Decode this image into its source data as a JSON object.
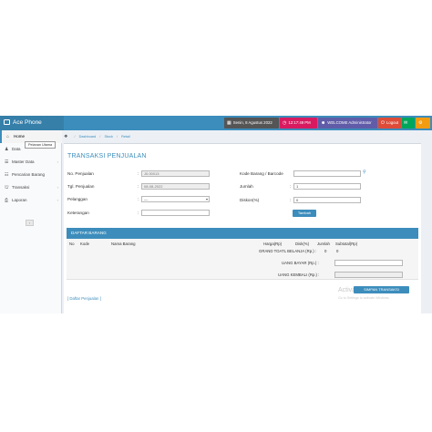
{
  "app": {
    "brand": "Ace Phone"
  },
  "topbar": {
    "date": "Senin, 8 Agustus 2022",
    "time": "12:17:49 PM",
    "user": "WELCOME Administrator",
    "logout": "Logout"
  },
  "sidebar": {
    "items": [
      {
        "label": "Home",
        "icon": "home-icon"
      },
      {
        "label": "Data",
        "icon": "user-icon"
      },
      {
        "label": "Master Data",
        "icon": "list-icon"
      },
      {
        "label": "Pencarian Barang",
        "icon": "search-list-icon"
      },
      {
        "label": "Transaksi",
        "icon": "cart-icon"
      },
      {
        "label": "Laporan",
        "icon": "print-icon"
      }
    ],
    "tooltip": "Pelanan Utama"
  },
  "breadcrumb": {
    "items": [
      "Dashboard",
      "Stock",
      "Retail"
    ]
  },
  "page": {
    "title": "TRANSAKSI PENJUALAN"
  },
  "form": {
    "no_penjualan_label": "No. Penjualan",
    "no_penjualan_value": "J0.00013",
    "tgl_penjualan_label": "Tgl. Penjualan",
    "tgl_penjualan_value": "08-08-2022",
    "pelanggan_label": "Pelanggan",
    "pelanggan_value": "—",
    "keterangan_label": "Keterangan",
    "keterangan_value": "",
    "kode_barang_label": "Kode Barang / Barcode",
    "kode_barang_value": "",
    "jumlah_label": "Jumlah",
    "jumlah_value": "1",
    "diskon_label": "Diskon(%)",
    "diskon_value": "0",
    "tambah_label": "Tambah"
  },
  "daftar": {
    "header": "DAFTAR BARANG",
    "columns": [
      "No",
      "Kode",
      "Nama Barang",
      "Harga(Rp)",
      "Disk(%)",
      "Jumlah",
      "Subtotal(Rp)"
    ],
    "grand_total_label": "GRAND TOATL BELANJA (Rp.) :",
    "grand_total_qty": "0",
    "grand_total_value": "0",
    "uang_bayar_label": "UANG BAYAR (Rp.) :",
    "uang_bayar_value": "",
    "uang_kembali_label": "UANG KEMBALI (Rp.) :",
    "uang_kembali_value": "",
    "simpan_label": "SIMPAN TRANSAKSI",
    "daftar_link": "[ Daftar Penjualan ]"
  },
  "watermark": {
    "title": "Activate Windows",
    "subtitle": "Go to Settings to activate Windows."
  },
  "colors": {
    "primary": "#3c8dbc",
    "brand_dark": "#367fa9",
    "time_pill": "#d81b60",
    "user_pill": "#605ca8",
    "logout_pill": "#dd4b39",
    "message_pill": "#00a65a"
  }
}
